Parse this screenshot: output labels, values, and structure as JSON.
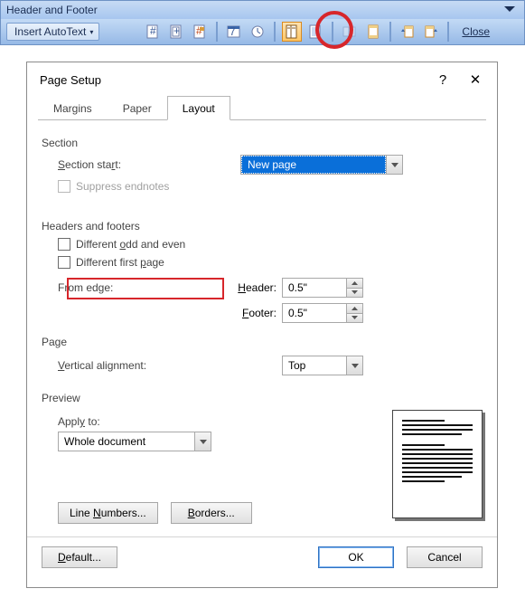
{
  "toolbar": {
    "title": "Header and Footer",
    "autotext": "Insert AutoText",
    "close": "Close",
    "icons": [
      "page-number-insert-icon",
      "page-count-insert-icon",
      "page-number-format-icon",
      "date-insert-icon",
      "time-insert-icon",
      "page-setup-icon",
      "show-hide-document-icon",
      "same-as-previous-icon",
      "switch-header-footer-icon",
      "show-previous-icon",
      "show-next-icon"
    ]
  },
  "dialog": {
    "title": "Page Setup",
    "help": "?",
    "close": "✕",
    "tabs": {
      "margins": "Margins",
      "paper": "Paper",
      "layout": "Layout"
    },
    "section": {
      "group": "Section",
      "start_label": "Section start:",
      "start_value": "New page",
      "suppress": "Suppress endnotes"
    },
    "hf": {
      "group": "Headers and footers",
      "odd_even": "Different odd and even",
      "first_page": "Different first page",
      "from_edge": "From edge:",
      "header_label": "Header:",
      "header_value": "0.5\"",
      "footer_label": "Footer:",
      "footer_value": "0.5\""
    },
    "page": {
      "group": "Page",
      "valign_label": "Vertical alignment:",
      "valign_value": "Top"
    },
    "preview": {
      "group": "Preview",
      "apply_label": "Apply to:",
      "apply_value": "Whole document"
    },
    "buttons": {
      "line_numbers": "Line Numbers...",
      "borders": "Borders...",
      "default": "Default...",
      "ok": "OK",
      "cancel": "Cancel"
    }
  }
}
